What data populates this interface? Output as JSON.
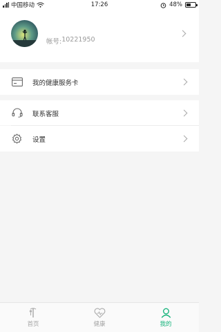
{
  "status_bar": {
    "carrier": "中国移动",
    "time": "17:26",
    "battery": "48%",
    "battery_level": 0.48,
    "icons": [
      "signal-icon",
      "wifi-icon",
      "alarm-icon",
      "battery-icon"
    ]
  },
  "profile": {
    "account_label": "帐号:",
    "account_number": "10221950",
    "avatar_icon": "avatar-photo"
  },
  "menu": {
    "health_card": "我的健康服务卡",
    "customer_service": "联系客服",
    "settings": "设置"
  },
  "tabbar": {
    "tabs": [
      {
        "label": "首页",
        "icon": "home-icon",
        "active": false
      },
      {
        "label": "健康",
        "icon": "health-icon",
        "active": false
      },
      {
        "label": "我的",
        "icon": "profile-icon",
        "active": true
      }
    ]
  },
  "colors": {
    "accent": "#19b47d",
    "inactive": "#a6a6a6",
    "background": "#f5f5f5"
  }
}
